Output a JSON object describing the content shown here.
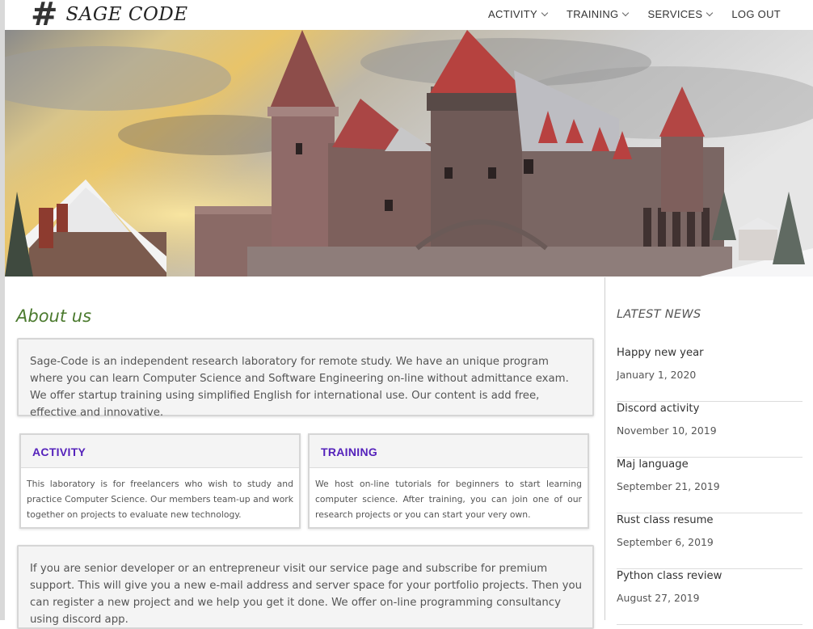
{
  "header": {
    "logo_symbol": "#",
    "logo_text": "SAGE CODE",
    "nav": [
      {
        "label": "ACTIVITY",
        "icon": "chevron-down-icon"
      },
      {
        "label": "TRAINING",
        "icon": "chevron-down-icon"
      },
      {
        "label": "SERVICES",
        "icon": "chevron-down-icon"
      },
      {
        "label": "LOG OUT"
      }
    ]
  },
  "main": {
    "about_title": "About us",
    "intro": "Sage-Code is an independent research laboratory for remote study. We have an unique program where you can learn Computer Science and Software Engineering on-line without admittance exam. We offer startup training using simplified English for international use. Our content is add free, effective and innovative.",
    "cards": [
      {
        "title": "ACTIVITY",
        "text": "This laboratory is for freelancers who wish to study and practice Computer Science. Our members team-up and work together on projects to evaluate new technology."
      },
      {
        "title": "TRAINING",
        "text": "We host on-line tutorials for beginners to start learning computer science. After training, you can join one of our research projects or you can start your very own."
      }
    ],
    "premium": "If you are senior developer or an entrepreneur visit our service page and subscribe for premium support. This will give you a new e-mail address and server space for your portfolio projects. Then you can register a new project and we help you get it done. We offer on-line programming consultancy using discord app."
  },
  "sidebar": {
    "title": "LATEST NEWS",
    "items": [
      {
        "title": "Happy new year",
        "date": "January 1, 2020"
      },
      {
        "title": "Discord activity",
        "date": "November 10, 2019"
      },
      {
        "title": "Maj language",
        "date": "September 21, 2019"
      },
      {
        "title": "Rust class resume",
        "date": "September 6, 2019"
      },
      {
        "title": "Python class review",
        "date": "August 27, 2019"
      }
    ]
  },
  "colors": {
    "about_title": "#4b7a2e",
    "card_title": "#5522bb",
    "box_background": "#f4f4f4"
  }
}
